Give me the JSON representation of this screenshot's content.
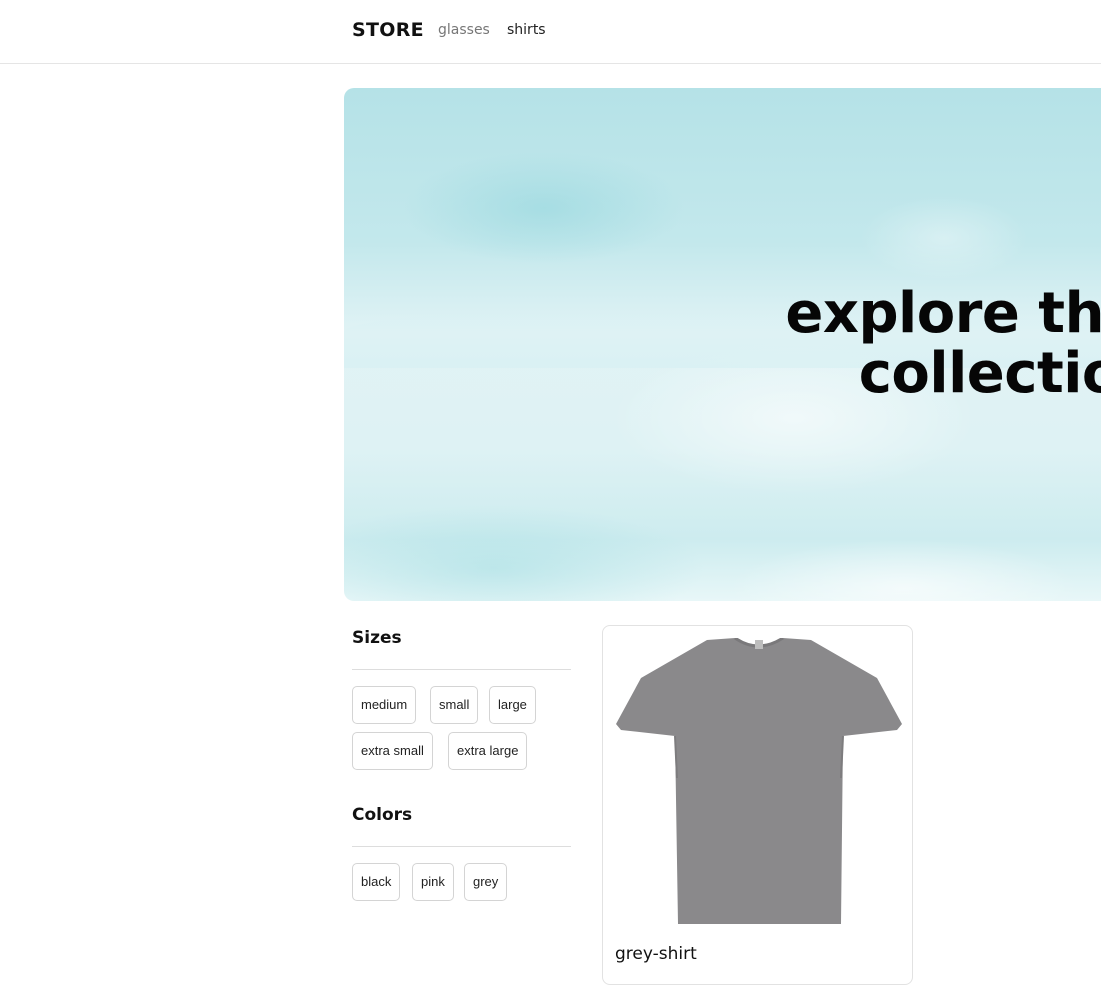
{
  "header": {
    "brand": "STORE",
    "nav": [
      {
        "label": "glasses"
      },
      {
        "label": "shirts"
      }
    ]
  },
  "hero": {
    "title": "explore the sh collection"
  },
  "filters": {
    "sizes": {
      "heading": "Sizes",
      "options": [
        "medium",
        "small",
        "large",
        "extra small",
        "extra large"
      ]
    },
    "colors": {
      "heading": "Colors",
      "options": [
        "black",
        "pink",
        "grey"
      ]
    }
  },
  "products": [
    {
      "name": "grey-shirt",
      "image": "grey-tshirt-image",
      "color": "#8a898b"
    }
  ]
}
